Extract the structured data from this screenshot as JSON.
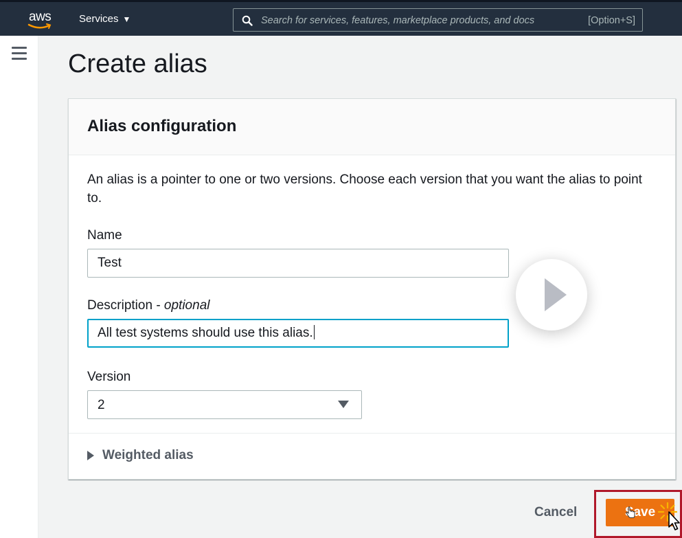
{
  "nav": {
    "logo_text": "aws",
    "services_label": "Services",
    "services_caret": "▼",
    "search_placeholder": "Search for services, features, marketplace products, and docs",
    "search_shortcut": "[Option+S]"
  },
  "page": {
    "title": "Create alias"
  },
  "panel": {
    "title": "Alias configuration",
    "description": "An alias is a pointer to one or two versions. Choose each version that you want the alias to point to.",
    "name_label": "Name",
    "name_value": "Test",
    "description_label": "Description - ",
    "description_optional": "optional",
    "description_value": "All test systems should use this alias.",
    "version_label": "Version",
    "version_value": "2",
    "weighted_alias_label": "Weighted alias"
  },
  "footer": {
    "cancel_label": "Cancel",
    "save_label": "Save"
  },
  "colors": {
    "nav_bg": "#232f3e",
    "primary_button": "#ec7211",
    "focus_border": "#00a1c9",
    "highlight_frame": "#b0182a"
  },
  "icons": {
    "logo": "aws-logo-icon",
    "search": "search-icon",
    "menu": "hamburger-menu-icon",
    "dropdown": "caret-down-icon",
    "expand": "caret-right-icon",
    "video": "play-icon",
    "pointer": "mouse-cursor-icon",
    "click": "click-burst-icon"
  }
}
